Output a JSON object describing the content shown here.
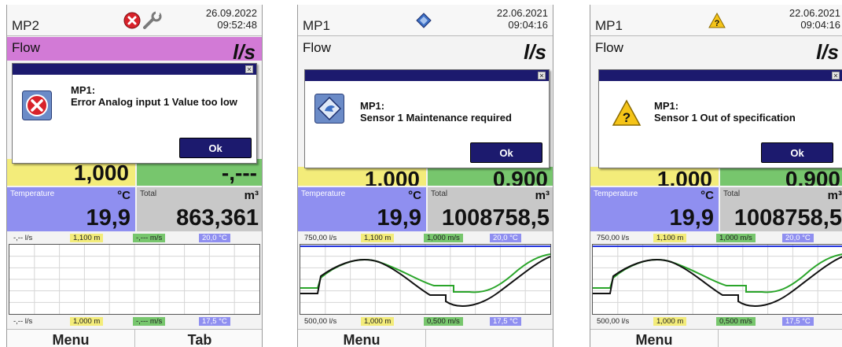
{
  "screens": [
    {
      "device": "MP2",
      "date": "26.09.2022",
      "time": "09:52:48",
      "status_icons": [
        "error-icon",
        "wrench-icon"
      ],
      "flow_label": "Flow",
      "flow_unit": "l/s",
      "flow_value": "1,000",
      "velocity_value": "-,---",
      "temperature_label": "Temperature",
      "temperature_unit": "°C",
      "temperature_value": "19,9",
      "total_label": "Total",
      "total_unit": "m³",
      "total_value": "863,361",
      "legend_top": {
        "flow": "-,-- l/s",
        "level": "1,100 m",
        "velocity": "-,--- m/s",
        "temperature": "20,0 °C"
      },
      "legend_bottom": {
        "flow": "-,-- l/s",
        "level": "1,000 m",
        "velocity": "-,--- m/s",
        "temperature": "17,5 °C"
      },
      "chart_has_curves": false,
      "dialog": {
        "icon": "error-icon",
        "title": "MP1:",
        "message": "Error Analog input 1 Value too low",
        "ok_label": "Ok"
      },
      "menu_label": "Menu",
      "tab_label": "Tab"
    },
    {
      "device": "MP1",
      "date": "22.06.2021",
      "time": "09:04:16",
      "status_icons": [
        "maintenance-icon"
      ],
      "flow_label": "Flow",
      "flow_unit": "l/s",
      "flow_value": "1,000",
      "velocity_value": "0,900",
      "temperature_label": "Temperature",
      "temperature_unit": "°C",
      "temperature_value": "19,9",
      "total_label": "Total",
      "total_unit": "m³",
      "total_value": "1008758,5",
      "legend_top": {
        "flow": "750,00 l/s",
        "level": "1,100 m",
        "velocity": "1,000 m/s",
        "temperature": "20,0 °C"
      },
      "legend_bottom": {
        "flow": "500,00 l/s",
        "level": "1,000 m",
        "velocity": "0,500 m/s",
        "temperature": "17,5 °C"
      },
      "chart_has_curves": true,
      "dialog": {
        "icon": "maintenance-icon",
        "title": "MP1:",
        "message": "Sensor 1 Maintenance required",
        "ok_label": "Ok"
      },
      "menu_label": "Menu",
      "tab_label": ""
    },
    {
      "device": "MP1",
      "date": "22.06.2021",
      "time": "09:04:16",
      "status_icons": [
        "warning-icon"
      ],
      "flow_label": "Flow",
      "flow_unit": "l/s",
      "flow_value": "1,000",
      "velocity_value": "0,900",
      "temperature_label": "Temperature",
      "temperature_unit": "°C",
      "temperature_value": "19,9",
      "total_label": "Total",
      "total_unit": "m³",
      "total_value": "1008758,5",
      "legend_top": {
        "flow": "750,00 l/s",
        "level": "1,100 m",
        "velocity": "1,000 m/s",
        "temperature": "20,0 °C"
      },
      "legend_bottom": {
        "flow": "500,00 l/s",
        "level": "1,000 m",
        "velocity": "0,500 m/s",
        "temperature": "17,5 °C"
      },
      "chart_has_curves": true,
      "dialog": {
        "icon": "warning-icon",
        "title": "MP1:",
        "message": "Sensor 1 Out of specification",
        "ok_label": "Ok"
      },
      "menu_label": "Menu",
      "tab_label": ""
    }
  ],
  "colors": {
    "dialog_titlebar": "#1c1a6e",
    "ok_button": "#1c1a6e",
    "flow_tile": "#f3ec7a",
    "velocity_tile": "#77c66d",
    "temperature_tile": "#8f8ff0",
    "total_tile": "#c8c8c8",
    "error_flow_header": "#d27ad6",
    "curve_green": "#2aa52a",
    "curve_black": "#111111",
    "curve_blue": "#2233dd"
  }
}
